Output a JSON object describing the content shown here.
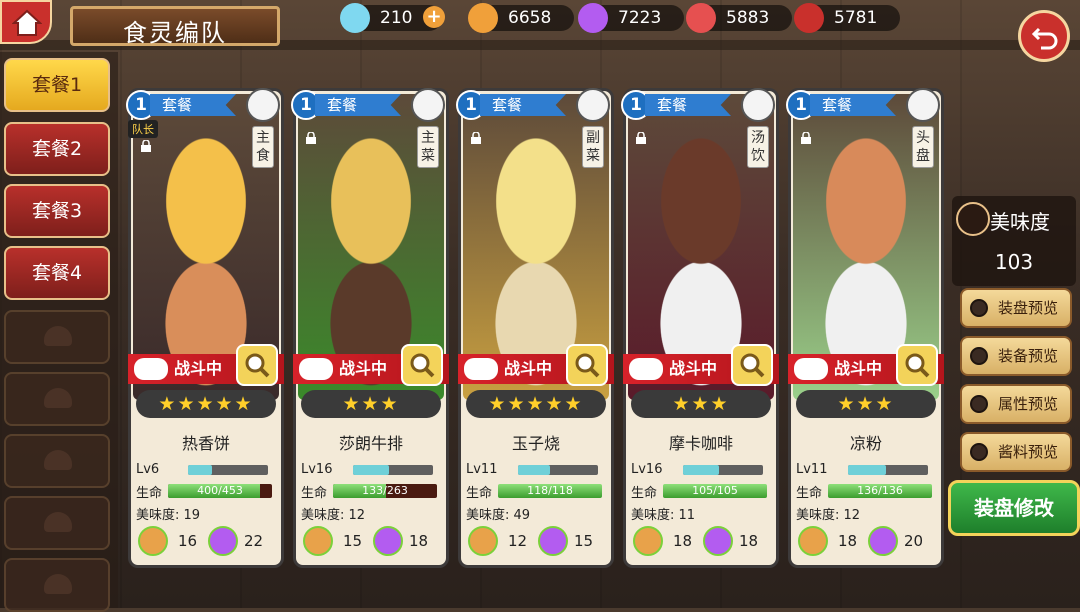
{
  "header": {
    "title": "食灵编队",
    "resources": [
      {
        "icon": "diamond-icon",
        "value": "210",
        "color": "#b9f0ff"
      },
      {
        "icon": "potion-flask-icon",
        "value": "6658",
        "color": "#f0a03a"
      },
      {
        "icon": "purple-crystal-icon",
        "value": "7223",
        "color": "#b35cf0"
      },
      {
        "icon": "meat-food-icon",
        "value": "5883",
        "color": "#e65050"
      },
      {
        "icon": "bomb-food-icon",
        "value": "5781",
        "color": "#c9302c"
      }
    ],
    "plus_label": "+"
  },
  "sidebar": {
    "sets": [
      {
        "label": "套餐1",
        "active": true
      },
      {
        "label": "套餐2",
        "active": false
      },
      {
        "label": "套餐3",
        "active": false
      },
      {
        "label": "套餐4",
        "active": false
      }
    ],
    "empty_slots": 5
  },
  "cards": [
    {
      "level_badge": "1",
      "set_label": "套餐",
      "role": "主食",
      "dish_icon": "bowl-icon",
      "captain": "队长",
      "status": "战斗中",
      "stars": "★★★★★",
      "name": "热香饼",
      "lv": "Lv6",
      "lv_progress": 0.3,
      "hp_label": "生命",
      "hp": "400/453",
      "hp_ratio": 0.883,
      "flavor_label": "美味度",
      "flavor": "19",
      "sauce1": "16",
      "sauce2": "22",
      "art_colors": [
        "#f4c04a",
        "#d98e5a",
        "#3a2a2a"
      ]
    },
    {
      "level_badge": "1",
      "set_label": "套餐",
      "role": "主菜",
      "dish_icon": "knife-icon",
      "captain": "",
      "status": "战斗中",
      "stars": "★★★",
      "name": "莎朗牛排",
      "lv": "Lv16",
      "lv_progress": 0.45,
      "hp_label": "生命",
      "hp": "133/263",
      "hp_ratio": 0.506,
      "flavor_label": "美味度",
      "flavor": "12",
      "sauce1": "15",
      "sauce2": "18",
      "art_colors": [
        "#e8c05a",
        "#5a3a2a",
        "#3a8a2a"
      ]
    },
    {
      "level_badge": "1",
      "set_label": "套餐",
      "role": "副菜",
      "dish_icon": "fork-icon",
      "captain": "",
      "status": "战斗中",
      "stars": "★★★★★",
      "name": "玉子烧",
      "lv": "Lv11",
      "lv_progress": 0.4,
      "hp_label": "生命",
      "hp": "118/118",
      "hp_ratio": 1.0,
      "flavor_label": "美味度",
      "flavor": "49",
      "sauce1": "12",
      "sauce2": "15",
      "art_colors": [
        "#f3e08a",
        "#e8d8b0",
        "#c9a040"
      ]
    },
    {
      "level_badge": "1",
      "set_label": "套餐",
      "role": "汤饮",
      "dish_icon": "soup-steam-icon",
      "captain": "",
      "status": "战斗中",
      "stars": "★★★",
      "name": "摩卡咖啡",
      "lv": "Lv16",
      "lv_progress": 0.45,
      "hp_label": "生命",
      "hp": "105/105",
      "hp_ratio": 1.0,
      "flavor_label": "美味度",
      "flavor": "11",
      "sauce1": "18",
      "sauce2": "18",
      "art_colors": [
        "#6a3a2a",
        "#f0f0f0",
        "#5a1a2a"
      ]
    },
    {
      "level_badge": "1",
      "set_label": "套餐",
      "role": "头盘",
      "dish_icon": "plate-icon",
      "captain": "",
      "status": "战斗中",
      "stars": "★★★",
      "name": "凉粉",
      "lv": "Lv11",
      "lv_progress": 0.48,
      "hp_label": "生命",
      "hp": "136/136",
      "hp_ratio": 1.0,
      "flavor_label": "美味度",
      "flavor": "12",
      "sauce1": "18",
      "sauce2": "20",
      "art_colors": [
        "#d88a5a",
        "#f0f0f0",
        "#9ad08a"
      ]
    }
  ],
  "right_panel": {
    "flavor_label": "美味度",
    "flavor_value": "103",
    "options": [
      "装盘预览",
      "装备预览",
      "属性预览",
      "酱料预览"
    ],
    "modify_button": "装盘修改"
  }
}
